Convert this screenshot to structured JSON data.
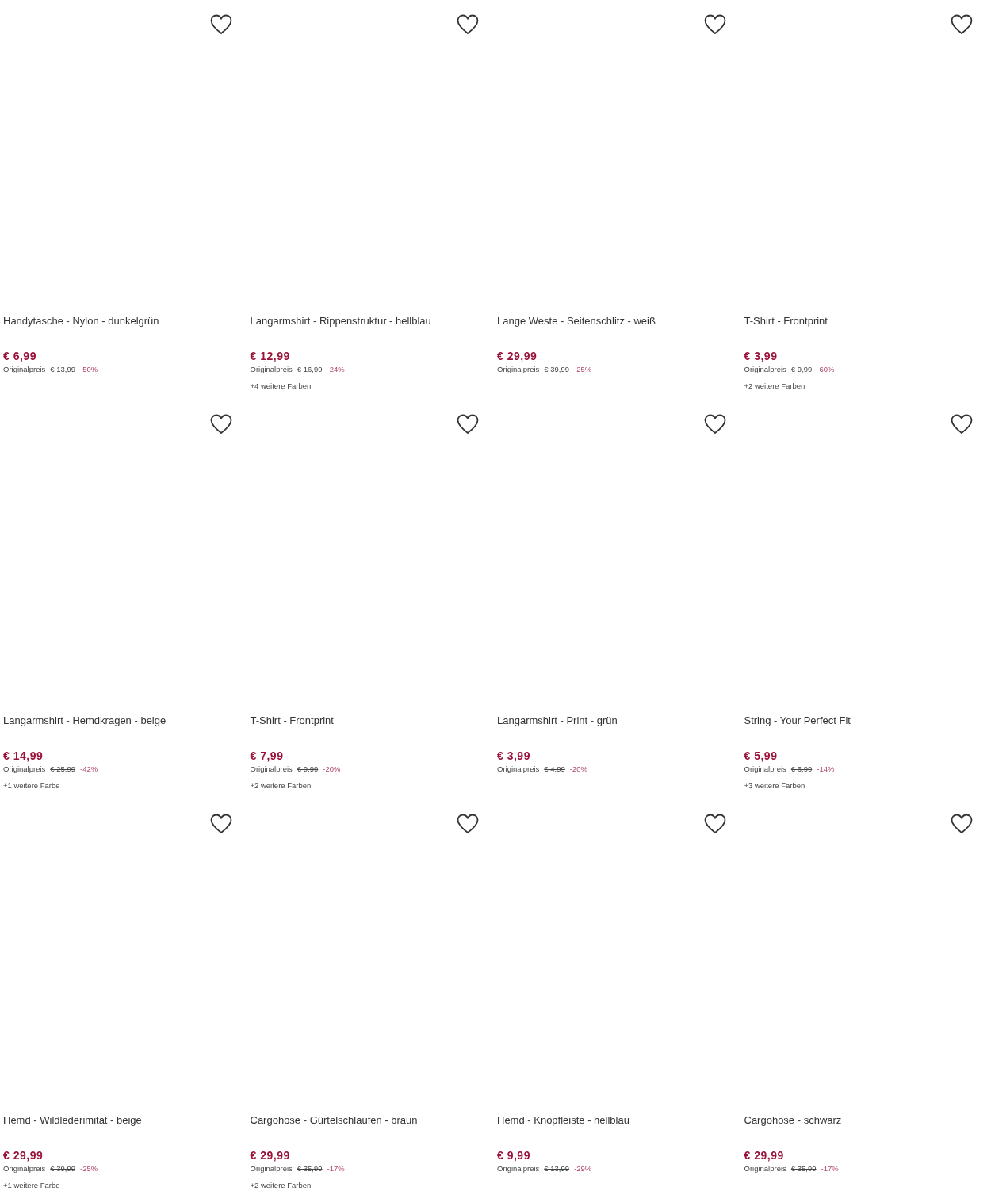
{
  "products": [
    {
      "title": "Handytasche - Nylon - dunkelgrün",
      "price": "€ 6,99",
      "original_label": "Originalpreis",
      "original_price": "€ 13,99",
      "discount": "-50%"
    },
    {
      "title": "Langarmshirt - Rippenstruktur - hellblau",
      "price": "€ 12,99",
      "original_label": "Originalpreis",
      "original_price": "€ 16,99",
      "discount": "-24%",
      "colors": "+4 weitere Farben"
    },
    {
      "title": "Lange Weste - Seitenschlitz - weiß",
      "price": "€ 29,99",
      "original_label": "Originalpreis",
      "original_price": "€ 39,99",
      "discount": "-25%"
    },
    {
      "title": "T-Shirt - Frontprint",
      "price": "€ 3,99",
      "original_label": "Originalpreis",
      "original_price": "€ 9,99",
      "discount": "-60%",
      "colors": "+2 weitere Farben"
    },
    {
      "title": "Langarmshirt - Hemdkragen - beige",
      "price": "€ 14,99",
      "original_label": "Originalpreis",
      "original_price": "€ 25,99",
      "discount": "-42%",
      "colors": "+1 weitere Farbe"
    },
    {
      "title": "T-Shirt - Frontprint",
      "price": "€ 7,99",
      "original_label": "Originalpreis",
      "original_price": "€ 9,99",
      "discount": "-20%",
      "colors": "+2 weitere Farben"
    },
    {
      "title": "Langarmshirt - Print - grün",
      "price": "€ 3,99",
      "original_label": "Originalpreis",
      "original_price": "€ 4,99",
      "discount": "-20%"
    },
    {
      "title": "String - Your Perfect Fit",
      "price": "€ 5,99",
      "original_label": "Originalpreis",
      "original_price": "€ 6,99",
      "discount": "-14%",
      "colors": "+3 weitere Farben"
    },
    {
      "title": "Hemd - Wildlederimitat - beige",
      "price": "€ 29,99",
      "original_label": "Originalpreis",
      "original_price": "€ 39,99",
      "discount": "-25%",
      "colors": "+1 weitere Farbe"
    },
    {
      "title": "Cargohose - Gürtelschlaufen - braun",
      "price": "€ 29,99",
      "original_label": "Originalpreis",
      "original_price": "€ 35,99",
      "discount": "-17%",
      "colors": "+2 weitere Farben"
    },
    {
      "title": "Hemd - Knopfleiste - hellblau",
      "price": "€ 9,99",
      "original_label": "Originalpreis",
      "original_price": "€ 13,99",
      "discount": "-29%"
    },
    {
      "title": "Cargohose - schwarz",
      "price": "€ 29,99",
      "original_label": "Originalpreis",
      "original_price": "€ 35,99",
      "discount": "-17%"
    }
  ]
}
